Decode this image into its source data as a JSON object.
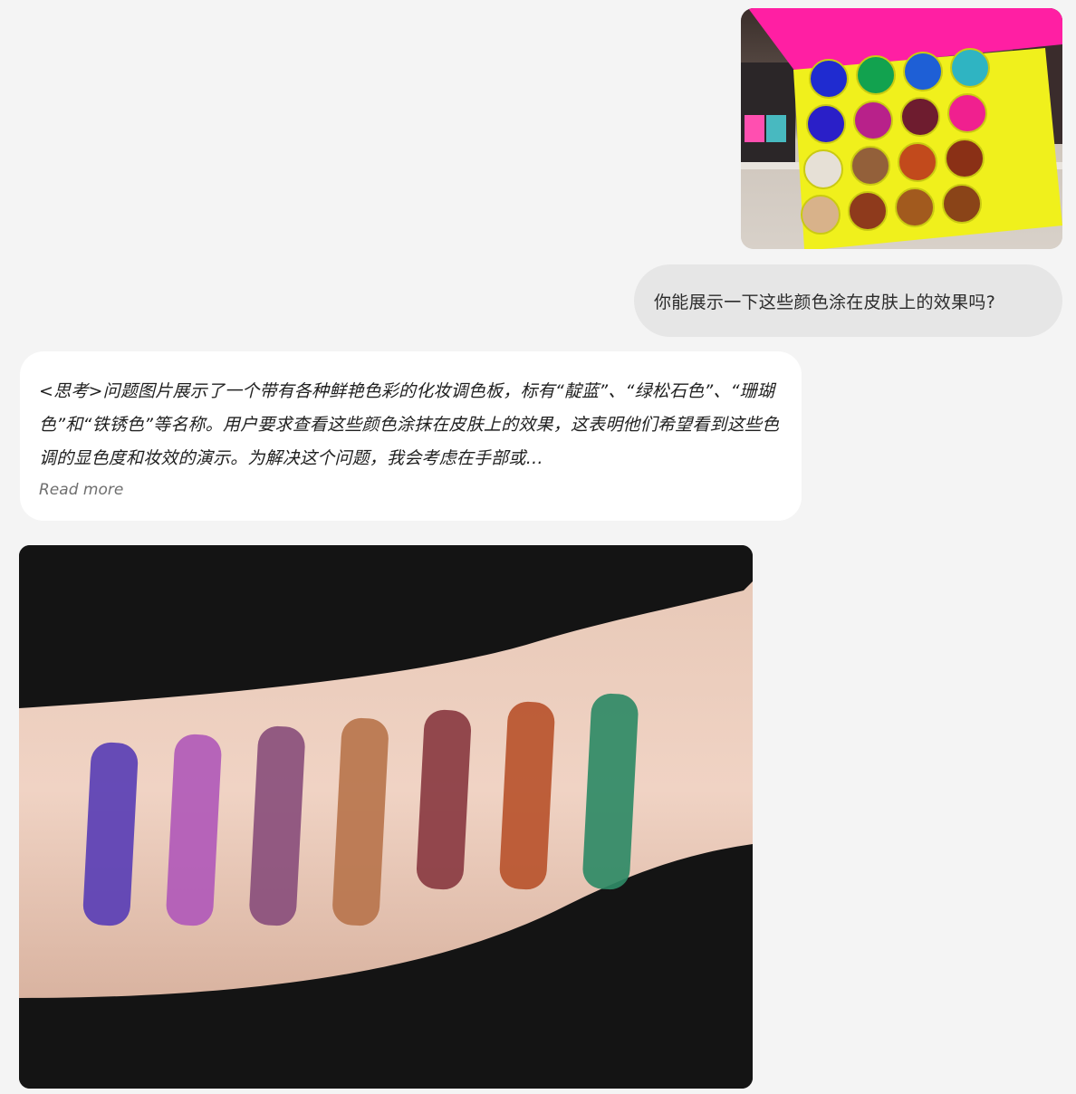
{
  "conversation": {
    "user_image": {
      "name": "eyeshadow palette photo",
      "icon": "palette-photo"
    },
    "user_message": "你能展示一下这些颜色涂在皮肤上的效果吗?",
    "assistant_thinking": {
      "text": "<思考>问题图片展示了一个带有各种鲜艳色彩的化妆调色板，标有“靛蓝”、“绿松石色”、“珊瑚色”和“铁锈色”等名称。用户要求查看这些颜色涂抹在皮肤上的效果，这表明他们希望看到这些色调的显色度和妆效的演示。为解决这个问题，我会考虑在手部或…",
      "read_more_label": "Read more"
    },
    "assistant_image": {
      "name": "arm swatches photo",
      "icon": "swatch-photo"
    }
  },
  "colors": {
    "page_background": "#f4f4f4",
    "user_bubble": "#e6e6e6",
    "assistant_card": "#ffffff",
    "palette_pink_lid": "#ff1fa3",
    "palette_yellow": "#f0f01c"
  },
  "palette_pans": [
    "#1f2bd0",
    "#12a24f",
    "#1e5fd6",
    "#2fb4c2",
    "#2a1fc8",
    "#b8218a",
    "#6e1c2f",
    "#f0208f",
    "#e6e0d6",
    "#93603a",
    "#c24a1c",
    "#8a3016",
    "#d8b28a",
    "#8e3a1c",
    "#a25a1e",
    "#8a4418"
  ],
  "swatches": [
    "#5a3fb5",
    "#b15ab8",
    "#8a4f7c",
    "#b8754d",
    "#8a3b42",
    "#b8542e",
    "#2f8a66"
  ]
}
